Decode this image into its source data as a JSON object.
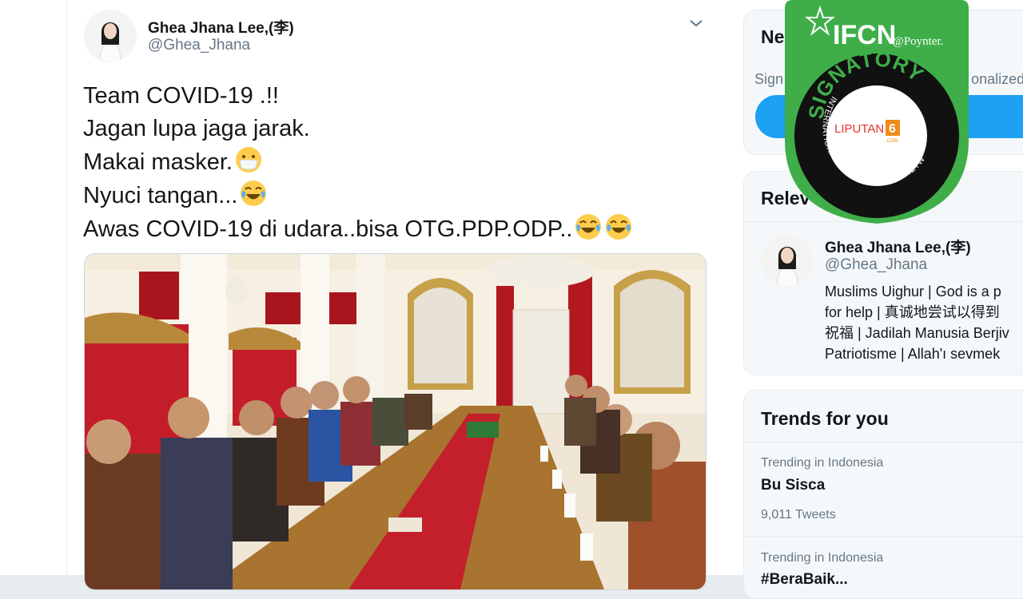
{
  "tweet": {
    "author_name": "Ghea Jhana Lee,(李)",
    "author_handle": "@Ghea_Jhana",
    "lines": {
      "l1": "Team COVID-19 .!!",
      "l2": "Jagan lupa jaga jarak.",
      "l3": "Makai masker.",
      "l4": "Nyuci tangan...",
      "l5": "Awas COVID-19 di udara..bisa OTG.PDP.ODP.."
    }
  },
  "sidebar": {
    "new_title": "Ne",
    "signup_sub_left": "Sign",
    "signup_sub_right": "onalized",
    "relevant_title": "Relev",
    "relevant_person": {
      "name": "Ghea Jhana Lee,(李)",
      "handle": "@Ghea_Jhana",
      "bio_lines": {
        "b1": "Muslims Uighur | God is a p",
        "b2": "for help | 真诚地尝试以得到",
        "b3": "祝福 | Jadilah Manusia Berjiv",
        "b4": "Patriotisme | Allah'ı sevmek"
      }
    },
    "trends_title": "Trends for you",
    "trends": [
      {
        "meta": "Trending in Indonesia",
        "name": "Bu Sisca",
        "count": "9,011 Tweets"
      },
      {
        "meta": "Trending in Indonesia",
        "name": "#BeraBaik..."
      }
    ]
  },
  "badge": {
    "brand": "IFCN",
    "partner": "@Poynter.",
    "ring_top": "SIGNATORY",
    "ring_bottom": "INTERNATIONAL FACT-CHECKING NETWORK",
    "logo_left": "LIPUTAN",
    "logo_num": "6",
    "logo_sub": ".COM"
  },
  "colors": {
    "accent": "#1da1f2",
    "badge_green": "#3fae49",
    "text_secondary": "#657786"
  },
  "icons": {
    "emoji_mask": "face-with-medical-mask",
    "emoji_laugh": "face-with-tears-of-joy",
    "menu": "chevron-down-icon"
  }
}
